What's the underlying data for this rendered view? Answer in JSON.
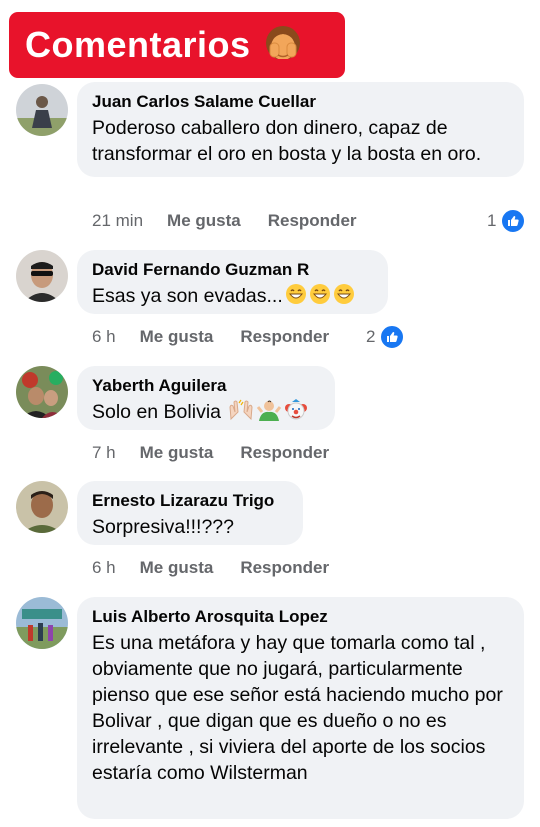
{
  "header": {
    "title": "Comentarios",
    "emoji_icon": "see-no-evil-person-emoji"
  },
  "actions": {
    "like": "Me gusta",
    "reply": "Responder"
  },
  "comments": [
    {
      "author": "Juan Carlos Salame Cuellar",
      "text": "Poderoso caballero don dinero, capaz de transformar el oro en bosta y la bosta en oro.",
      "time": "21 min",
      "reactions": "1"
    },
    {
      "author": "David Fernando Guzman R",
      "text": "Esas ya son evadas...",
      "emojis": [
        "grinning-face-emoji",
        "grinning-face-emoji",
        "grinning-face-emoji"
      ],
      "time": "6 h",
      "reactions": "2"
    },
    {
      "author": "Yaberth Aguilera",
      "text": "Solo en Bolivia",
      "emojis": [
        "raising-hands-emoji",
        "person-shrugging-emoji",
        "clown-face-emoji"
      ],
      "time": "7 h"
    },
    {
      "author": "Ernesto Lizarazu Trigo",
      "text": "Sorpresiva!!!???",
      "time": "6 h"
    },
    {
      "author": "Luis Alberto Arosquita Lopez",
      "text": "Es una metáfora y hay que tomarla como tal , obviamente que no jugará, particularmente pienso que ese señor está haciendo mucho por Bolivar , que digan que es dueño o no es irrelevante , si viviera del aporte de los socios estaría como Wilsterman"
    }
  ],
  "colors": {
    "badge": "#e8132b",
    "bubble": "#f0f2f5",
    "meta": "#65676b",
    "like": "#1877f2"
  }
}
